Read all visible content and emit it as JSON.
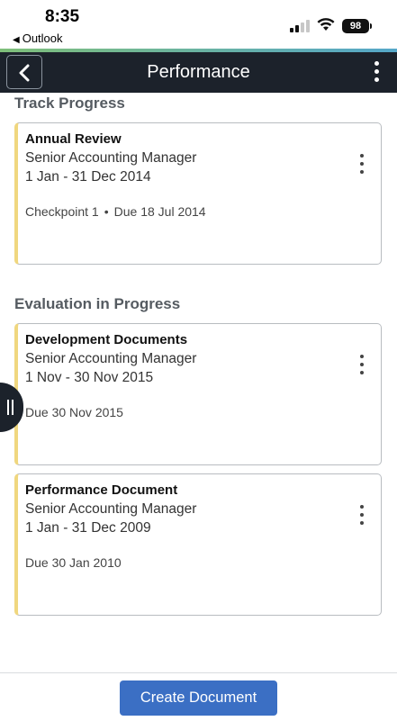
{
  "status_bar": {
    "time": "8:35",
    "back_app": "Outlook",
    "battery": "98"
  },
  "header": {
    "title": "Performance",
    "back_icon": "chevron-left-icon",
    "menu_icon": "vertical-ellipsis-icon"
  },
  "sections": [
    {
      "title": "Track Progress",
      "cards": [
        {
          "title": "Annual Review",
          "role": "Senior Accounting Manager",
          "period": "1 Jan - 31 Dec 2014",
          "checkpoint": "Checkpoint 1",
          "due": "Due 18 Jul 2014"
        }
      ]
    },
    {
      "title": "Evaluation in Progress",
      "cards": [
        {
          "title": "Development Documents",
          "role": "Senior Accounting Manager",
          "period": "1 Nov - 30 Nov 2015",
          "due": "Due 30 Nov 2015"
        },
        {
          "title": "Performance Document",
          "role": "Senior Accounting Manager",
          "period": "1 Jan - 31 Dec 2009",
          "due": "Due 30 Jan 2010"
        }
      ]
    }
  ],
  "footer": {
    "create_label": "Create Document"
  },
  "colors": {
    "header_bg": "#1c222b",
    "card_accent": "#f0d77f",
    "primary_button": "#3b6fc4"
  }
}
